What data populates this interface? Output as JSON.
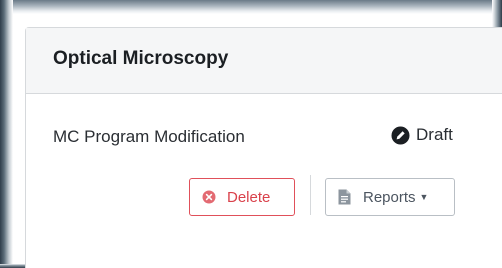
{
  "card": {
    "title": "Optical Microscopy",
    "program_name": "MC Program Modification",
    "status": {
      "label": "Draft",
      "icon": "pencil-circle-icon"
    },
    "actions": {
      "delete_label": "Delete",
      "delete_icon": "x-circle-icon",
      "reports_label": "Reports",
      "reports_icon": "document-icon",
      "reports_caret_icon": "caret-down-icon"
    }
  },
  "colors": {
    "danger": "#d9414b",
    "header_bg": "#f5f6f7",
    "border": "#d6d9dc"
  }
}
